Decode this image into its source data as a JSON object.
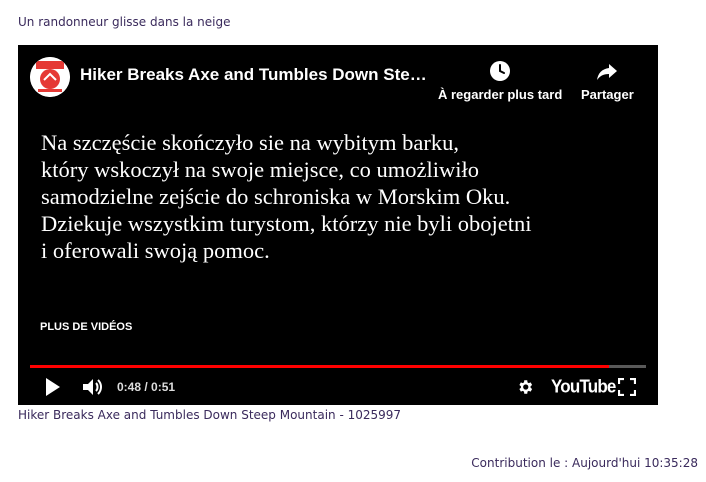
{
  "page": {
    "caption": "Un randonneur glisse dans la neige",
    "video_link": "Hiker Breaks Axe and Tumbles Down Steep Mountain - 1025997",
    "contribution": "Contribution le : Aujourd'hui 10:35:28"
  },
  "player": {
    "title": "Hiker Breaks Axe and Tumbles Down Steep Mountain",
    "channel_avatar_icon": "channel-logo-icon",
    "watch_later_label": "À regarder plus tard",
    "share_label": "Partager",
    "subtitle_lines": [
      "Na szczęście skończyło sie na wybitym barku,",
      "który wskoczył na swoje miejsce, co umożliwiło",
      "samodzielne zejście do schroniska w Morskim Oku.",
      "Dziekuje wszystkim turystom, którzy nie byli obojetni",
      "i oferowali swoją pomoc."
    ],
    "more_videos_label": "PLUS DE VIDÉOS",
    "time": "0:48 / 0:51",
    "progress_fraction": 0.94,
    "logo_text": "YouTube",
    "accent_color": "#ff0000"
  }
}
